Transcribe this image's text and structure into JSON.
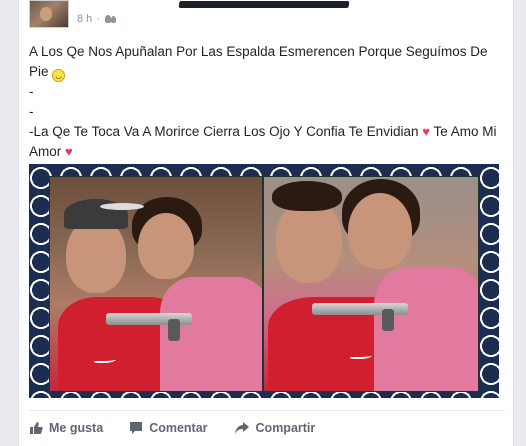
{
  "post": {
    "timestamp": "8 h",
    "separator": "·",
    "audience_icon": "friends-icon",
    "lines": [
      "A Los Qe Nos Apuñalan Por Las Espalda Esmerencen Porque Seguímos De Pie",
      "-",
      "-",
      "-La Qe Te Toca Va A Morirce Cierra Los Ojo Y Confia Te Envidian",
      "Te Amo Mi Amor"
    ]
  },
  "actions": {
    "like": "Me gusta",
    "comment": "Comentar",
    "share": "Compartir"
  },
  "colors": {
    "text": "#1d2129",
    "meta": "#90949c",
    "action": "#616770",
    "heart": "#e0405a",
    "photo_bg": "#1c2d52"
  }
}
